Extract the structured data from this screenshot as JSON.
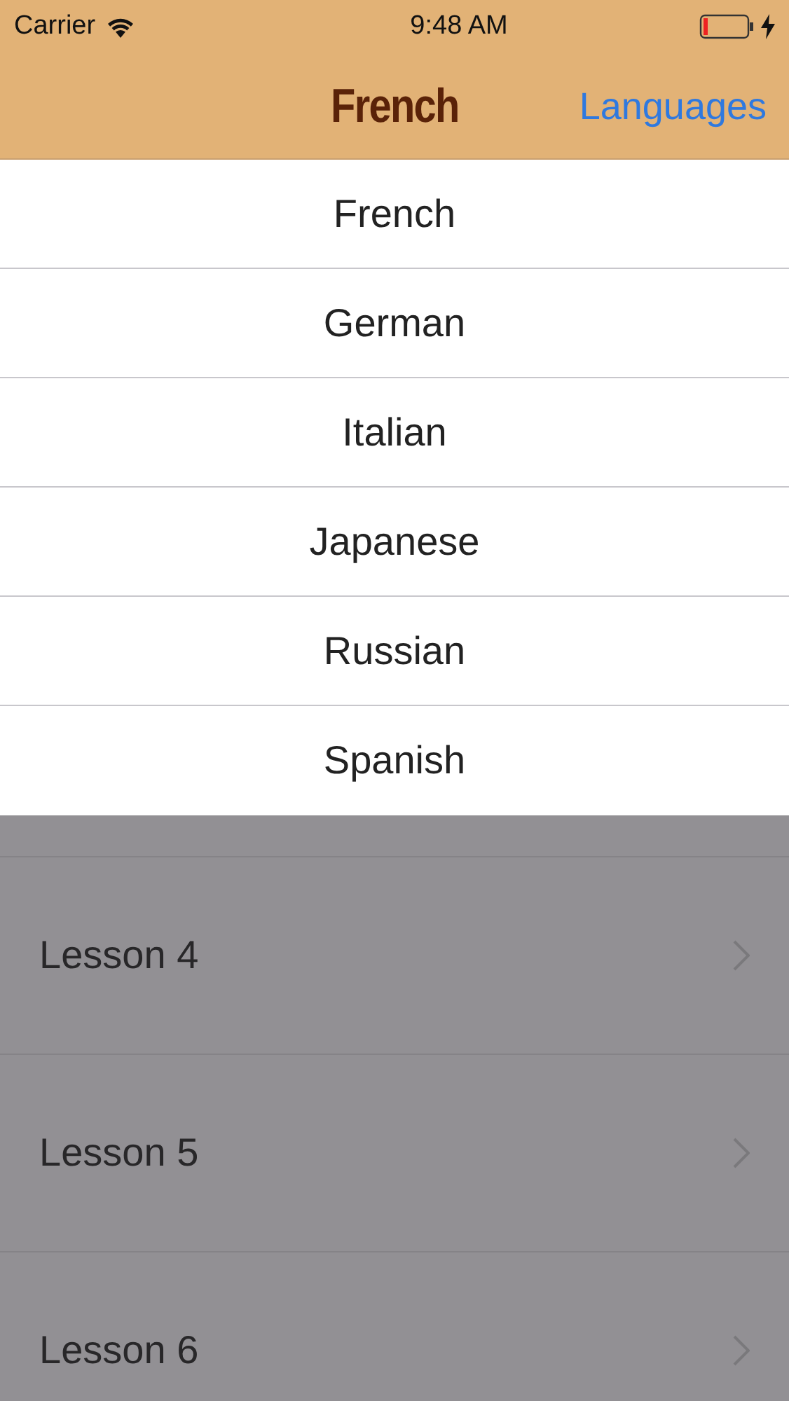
{
  "status_bar": {
    "carrier": "Carrier",
    "time": "9:48 AM"
  },
  "nav": {
    "title": "French",
    "button": "Languages"
  },
  "language_menu": [
    {
      "label": "French"
    },
    {
      "label": "German"
    },
    {
      "label": "Italian"
    },
    {
      "label": "Japanese"
    },
    {
      "label": "Russian"
    },
    {
      "label": "Spanish"
    }
  ],
  "lessons": [
    {
      "label": "Lesson 4"
    },
    {
      "label": "Lesson 5"
    },
    {
      "label": "Lesson 6"
    }
  ]
}
